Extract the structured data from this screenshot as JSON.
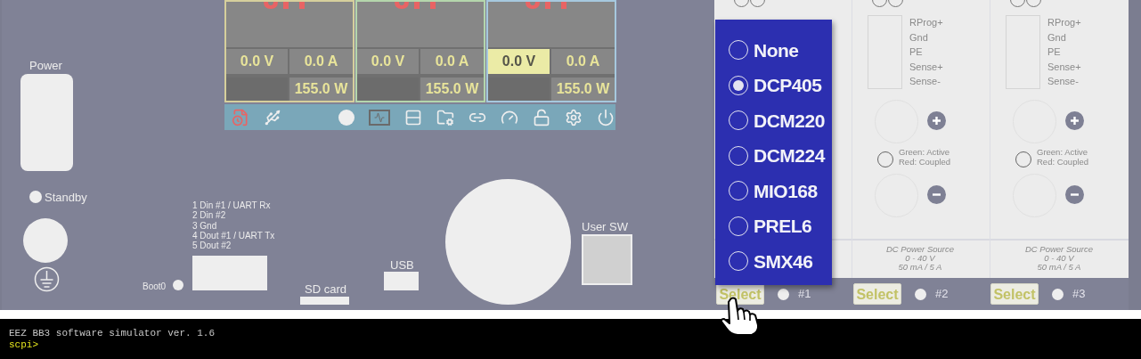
{
  "front_panel": {
    "power_label": "Power",
    "standby_label": "Standby",
    "io_port_lines": [
      "1 Din #1 / UART Rx",
      "2 Din #2",
      "3 Gnd",
      "4 Dout #1 / UART Tx",
      "5 Dout #2"
    ],
    "boot0_label": "Boot0",
    "sd_card_label": "SD card",
    "usb_label": "USB",
    "user_sw_label": "User SW"
  },
  "channels": [
    {
      "color": "#d6cf9c",
      "voltage": "0.0 V",
      "current": "0.0 A",
      "power": "155.0 W",
      "voltage_selected": false
    },
    {
      "color": "#b4d6ac",
      "voltage": "0.0 V",
      "current": "0.0 A",
      "power": "155.0 W",
      "voltage_selected": false
    },
    {
      "color": "#a6c8de",
      "voltage": "0.0 V",
      "current": "0.0 A",
      "power": "155.0 W",
      "voltage_selected": true
    }
  ],
  "slots": [
    {
      "select": "Select",
      "number": "#1"
    },
    {
      "pins": [
        "RProg+",
        "Gnd",
        "PE",
        "Sense+",
        "Sense-"
      ],
      "led_legend": [
        "Green: Active",
        "Red: Coupled"
      ],
      "description": [
        "DC Power Source",
        "0 - 40 V",
        "50 mA / 5 A"
      ],
      "select": "Select",
      "number": "#2"
    },
    {
      "pins": [
        "RProg+",
        "Gnd",
        "PE",
        "Sense+",
        "Sense-"
      ],
      "led_legend": [
        "Green: Active",
        "Red: Coupled"
      ],
      "description": [
        "DC Power Source",
        "0 - 40 V",
        "50 mA / 5 A"
      ],
      "select": "Select",
      "number": "#3"
    }
  ],
  "module_menu": {
    "options": [
      {
        "label": "None",
        "selected": false
      },
      {
        "label": "DCP405",
        "selected": true
      },
      {
        "label": "DCM220",
        "selected": false
      },
      {
        "label": "DCM224",
        "selected": false
      },
      {
        "label": "MIO168",
        "selected": false
      },
      {
        "label": "PREL6",
        "selected": false
      },
      {
        "label": "SMX46",
        "selected": false
      }
    ]
  },
  "terminal": {
    "lines": [
      {
        "kind": "output",
        "text": "EEZ BB3 software simulator ver. 1.6"
      },
      {
        "kind": "prompt",
        "text": "scpi>"
      }
    ]
  }
}
